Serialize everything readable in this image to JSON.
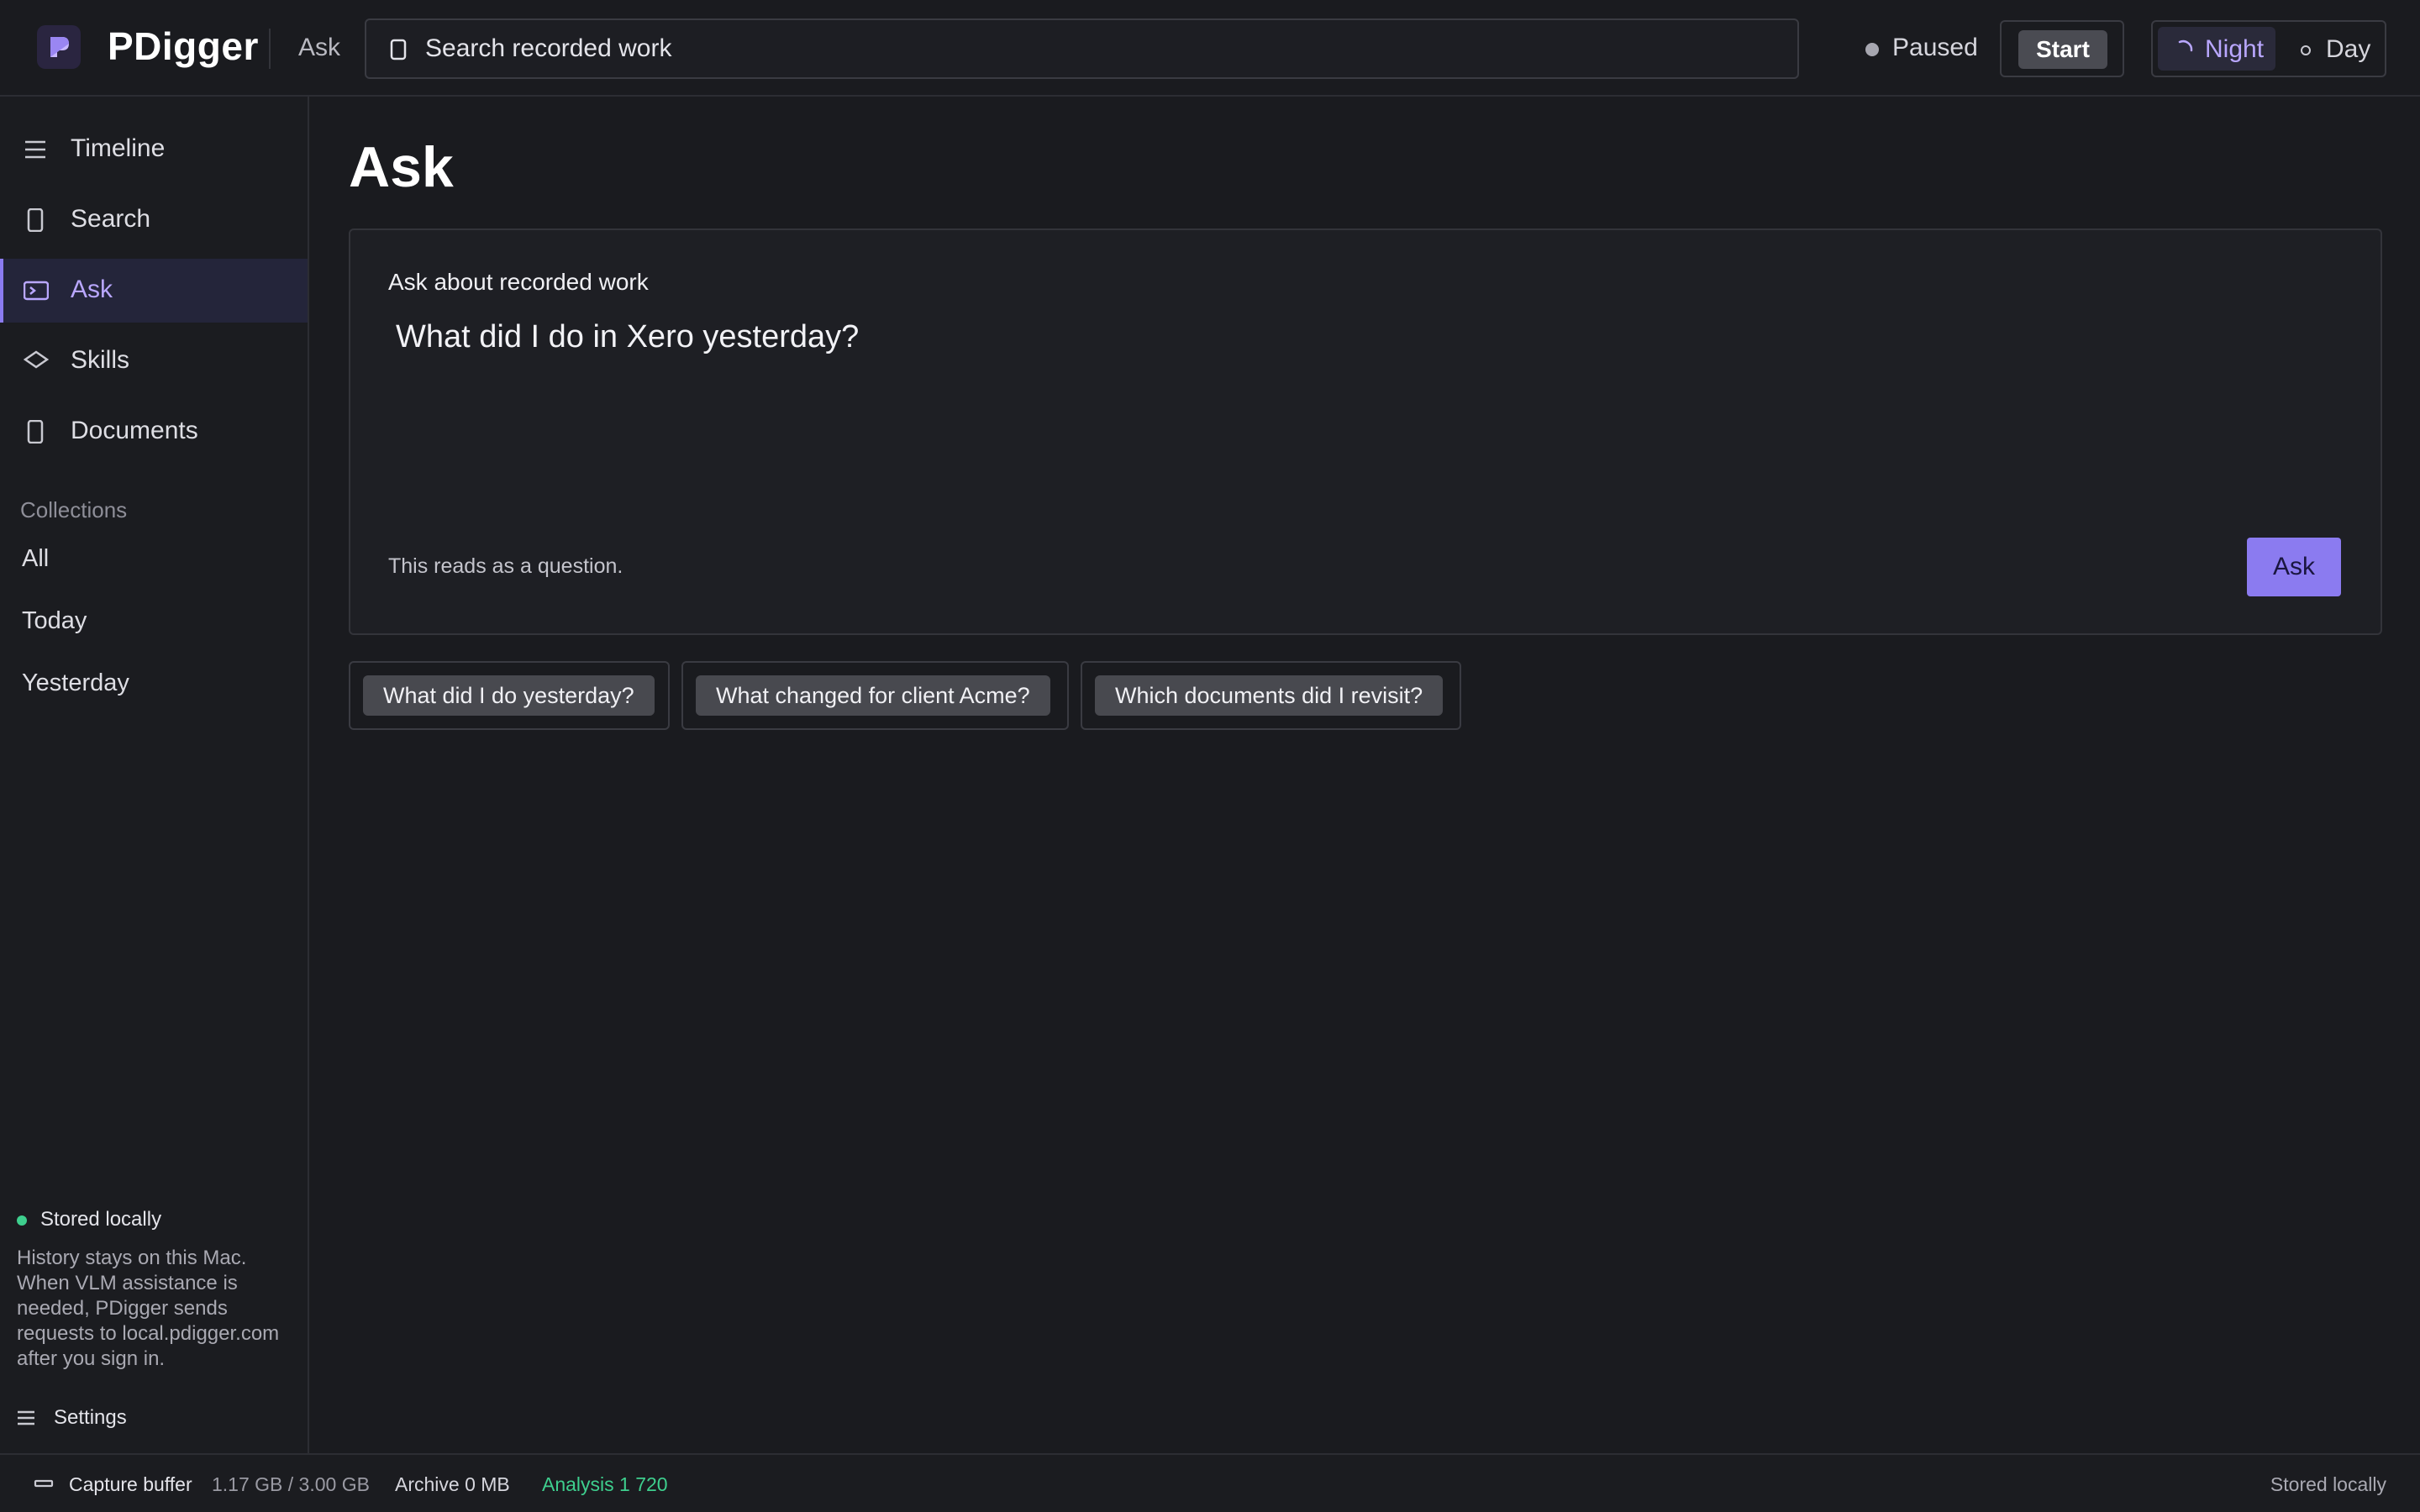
{
  "app": {
    "name": "PDigger",
    "breadcrumb": "Ask"
  },
  "topbar": {
    "search_placeholder": "Search recorded work",
    "status": "Paused",
    "start_label": "Start",
    "theme": {
      "night_label": "Night",
      "day_label": "Day",
      "active": "Night"
    }
  },
  "sidebar": {
    "items": [
      {
        "label": "Timeline",
        "icon": "list-icon"
      },
      {
        "label": "Search",
        "icon": "document-icon"
      },
      {
        "label": "Ask",
        "icon": "terminal-icon",
        "active": true
      },
      {
        "label": "Skills",
        "icon": "diamond-icon"
      },
      {
        "label": "Documents",
        "icon": "document-icon"
      }
    ],
    "collections_heading": "Collections",
    "collections": [
      "All",
      "Today",
      "Yesterday"
    ],
    "storage": {
      "title": "Stored locally",
      "description": "History stays on this Mac. When VLM assistance is needed, PDigger sends requests to local.pdigger.com after you sign in."
    },
    "settings_label": "Settings"
  },
  "main": {
    "title": "Ask",
    "card": {
      "label": "Ask about recorded work",
      "question": "What did I do in Xero yesterday?",
      "hint": "This reads as a question.",
      "ask_button": "Ask"
    },
    "suggestions": [
      "What did I do yesterday?",
      "What changed for client Acme?",
      "Which documents did I revisit?"
    ]
  },
  "statusbar": {
    "capture_label": "Capture buffer",
    "capture_value": "1.17 GB / 3.00 GB",
    "archive": "Archive 0 MB",
    "analysis": "Analysis 1 720",
    "storage": "Stored locally"
  },
  "colors": {
    "accent": "#8b7bf0",
    "accent_text": "#b9a7ff",
    "success": "#3ecf8e",
    "background": "#1a1b1f"
  }
}
